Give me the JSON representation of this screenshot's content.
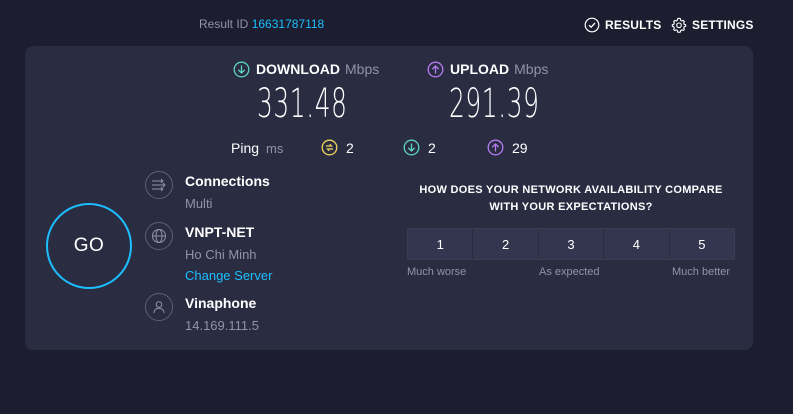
{
  "header": {
    "result_label": "Result ID",
    "result_id": "16631787118",
    "results_label": "RESULTS",
    "settings_label": "SETTINGS"
  },
  "download": {
    "label": "DOWNLOAD",
    "unit": "Mbps",
    "value": "331.48"
  },
  "upload": {
    "label": "UPLOAD",
    "unit": "Mbps",
    "value": "291.39"
  },
  "ping": {
    "label": "Ping",
    "unit": "ms",
    "idle": "2",
    "download": "2",
    "upload": "29"
  },
  "go_label": "GO",
  "connections": {
    "title": "Connections",
    "value": "Multi"
  },
  "server": {
    "name": "VNPT-NET",
    "location": "Ho Chi Minh",
    "change_label": "Change Server"
  },
  "provider": {
    "name": "Vinaphone",
    "ip": "14.169.111.5"
  },
  "survey": {
    "question": "HOW DOES YOUR NETWORK AVAILABILITY COMPARE WITH YOUR EXPECTATIONS?",
    "options": [
      "1",
      "2",
      "3",
      "4",
      "5"
    ],
    "low_label": "Much worse",
    "mid_label": "As expected",
    "high_label": "Much better"
  },
  "colors": {
    "background": "#1c1d2f",
    "panel": "#2a2c42",
    "accent_cyan": "#1cbfff",
    "download_icon": "#5fd3c5",
    "upload_icon": "#b67cf2",
    "idle_icon": "#f2d55c",
    "muted_text": "#9193a8"
  },
  "icons": {
    "results": "check-circle-icon",
    "settings": "gear-icon",
    "download": "arrow-down-circle-icon",
    "upload": "arrow-up-circle-icon",
    "idle_ping": "idle-latency-icon",
    "connections": "connections-icon",
    "server": "globe-icon",
    "provider": "user-icon"
  }
}
